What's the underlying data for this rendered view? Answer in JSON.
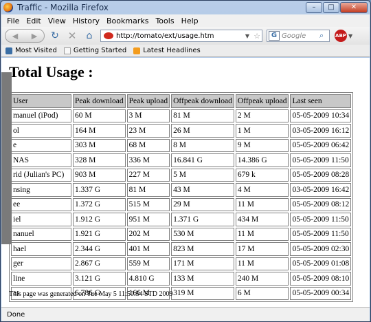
{
  "window": {
    "title": "Traffic - Mozilla Firefox",
    "buttons": [
      "–",
      "□",
      "✕"
    ]
  },
  "menu": [
    "File",
    "Edit",
    "View",
    "History",
    "Bookmarks",
    "Tools",
    "Help"
  ],
  "nav": {
    "back": "◀",
    "forward": "▶",
    "reload": "↻",
    "stop": "✕",
    "home": "⌂"
  },
  "address": {
    "url": "http://tomato/ext/usage.htm"
  },
  "search": {
    "engine": "G",
    "placeholder": "Google"
  },
  "bookmarks": [
    "Most Visited",
    "Getting Started",
    "Latest Headlines"
  ],
  "page": {
    "heading": "Total Usage :",
    "footer": "This page was generated on Tue May 5 11:50:54 STD 2009"
  },
  "table": {
    "headers": [
      "User",
      "Peak download",
      "Peak upload",
      "Offpeak download",
      "Offpeak upload",
      "Last seen"
    ],
    "rows": [
      [
        "manuel (iPod)",
        "60 M",
        "3 M",
        "81 M",
        "2 M",
        "05-05-2009 10:34"
      ],
      [
        "ol",
        "164 M",
        "23 M",
        "26 M",
        "1 M",
        "03-05-2009 16:12"
      ],
      [
        "e",
        "303 M",
        "68 M",
        "8 M",
        "9 M",
        "05-05-2009 06:42"
      ],
      [
        "NAS",
        "328 M",
        "336 M",
        "16.841 G",
        "14.386 G",
        "05-05-2009 11:50"
      ],
      [
        "rid (Julian's PC)",
        "903 M",
        "227 M",
        "5 M",
        "679 k",
        "05-05-2009 08:28"
      ],
      [
        "nsing",
        "1.337 G",
        "81 M",
        "43 M",
        "4 M",
        "03-05-2009 16:42"
      ],
      [
        "ee",
        "1.372 G",
        "515 M",
        "29 M",
        "11 M",
        "05-05-2009 08:12"
      ],
      [
        "iel",
        "1.912 G",
        "951 M",
        "1.371 G",
        "434 M",
        "05-05-2009 11:50"
      ],
      [
        "nanuel",
        "1.921 G",
        "202 M",
        "530 M",
        "11 M",
        "05-05-2009 11:50"
      ],
      [
        "hael",
        "2.344 G",
        "401 M",
        "823 M",
        "17 M",
        "05-05-2009 02:30"
      ],
      [
        "ger",
        "2.867 G",
        "559 M",
        "171 M",
        "11 M",
        "05-05-2009 01:08"
      ],
      [
        "line",
        "3.121 G",
        "4.810 G",
        "133 M",
        "240 M",
        "05-05-2009 08:10"
      ],
      [
        "as",
        "6.786 G",
        "166 M",
        "319 M",
        "6 M",
        "05-05-2009 00:34"
      ]
    ]
  },
  "status": {
    "text": "Done"
  }
}
